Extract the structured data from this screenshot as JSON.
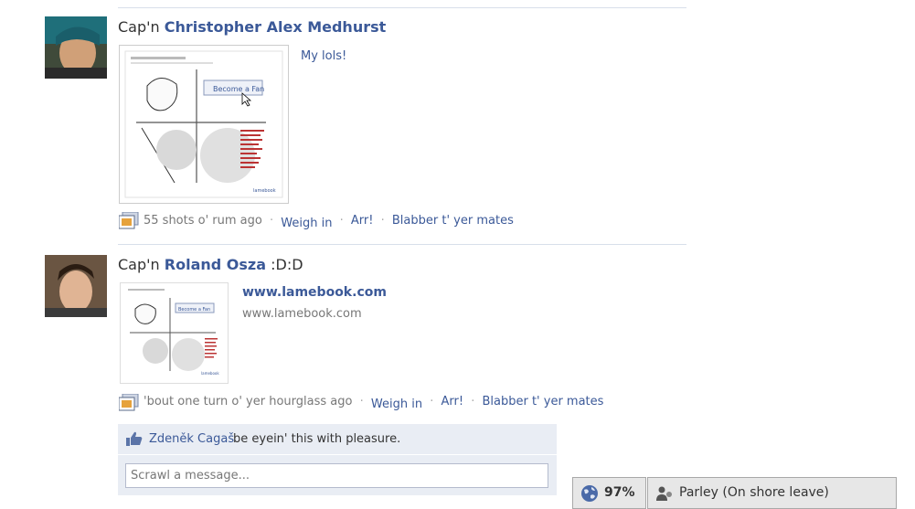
{
  "stories": [
    {
      "prefix": "Cap'n",
      "name": "Christopher Alex Medhurst",
      "caption": "My lols!",
      "time": "55 shots o' rum ago",
      "actions": [
        "Weigh in",
        "Arr!",
        "Blabber t' yer mates"
      ],
      "thumb_button": "Become a Fan",
      "thumb_site": "lamebook"
    },
    {
      "prefix": "Cap'n",
      "name": "Roland Osza",
      "suffix": ":D:D",
      "link_title": "www.lamebook.com",
      "link_url": "www.lamebook.com",
      "time": "'bout one turn o' yer hourglass ago",
      "actions": [
        "Weigh in",
        "Arr!",
        "Blabber t' yer mates"
      ],
      "thumb_button": "Become a Fan",
      "thumb_site": "lamebook",
      "likes": {
        "name": "Zdeněk Cagaš",
        "text": "be eyein' this with pleasure."
      },
      "comment_placeholder": "Scrawl a message..."
    }
  ],
  "chatbar": {
    "progress_text": "97%",
    "progress_value": 97,
    "chat_label": "Parley (On shore leave)"
  },
  "colors": {
    "link": "#3b5998",
    "meta": "#777777",
    "likes_bg": "#e9edf4"
  }
}
